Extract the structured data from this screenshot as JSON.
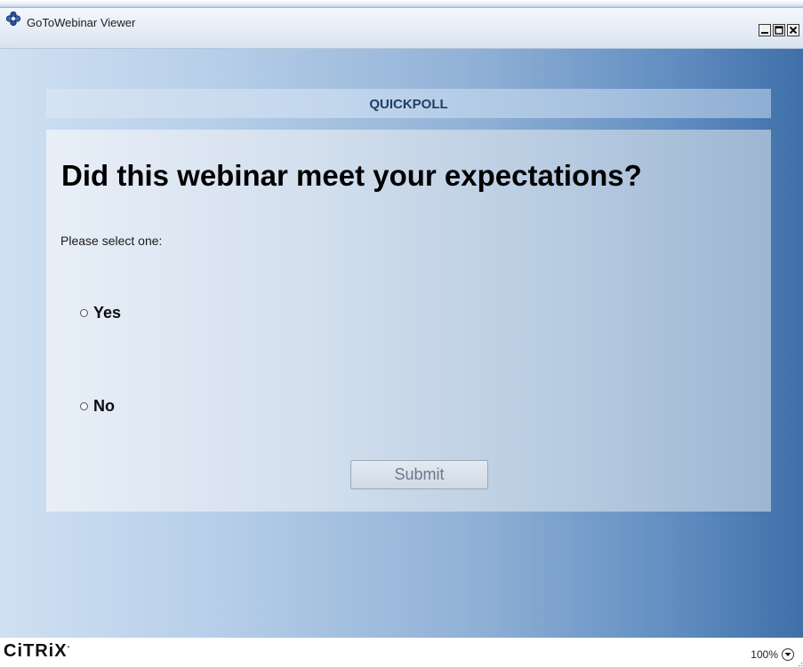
{
  "window": {
    "title": "GoToWebinar Viewer"
  },
  "poll": {
    "header": "QUICKPOLL",
    "question": "Did this webinar meet your expectations?",
    "instruction": "Please select one:",
    "options": [
      {
        "label": "Yes",
        "selected": false
      },
      {
        "label": "No",
        "selected": false
      }
    ],
    "submit_label": "Submit",
    "submit_enabled": false
  },
  "statusbar": {
    "brand": "CiTRiX",
    "brand_mark": "·",
    "zoom": "100%"
  },
  "icons": {
    "app": "gotowebinar-flower-icon",
    "minimize": "minimize-icon",
    "maximize": "maximize-icon",
    "close": "close-icon",
    "zoom_menu": "chevron-down-icon"
  },
  "colors": {
    "header_text": "#1f3f66",
    "background_dark": "#3f6fa8",
    "background_light": "#cfe0f2"
  }
}
